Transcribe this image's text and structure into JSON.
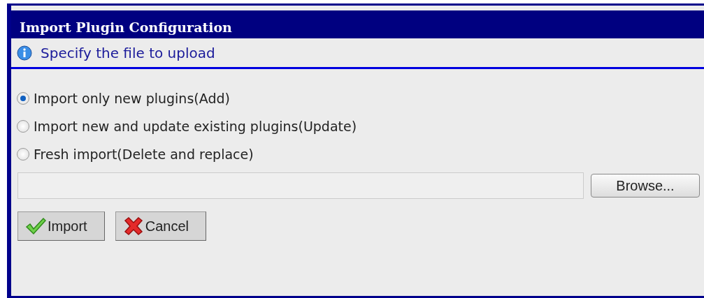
{
  "dialog": {
    "title": "Import Plugin Configuration",
    "info": "Specify the file to upload",
    "options": [
      {
        "label": "Import only new plugins(Add)",
        "selected": true
      },
      {
        "label": "Import new and update existing plugins(Update)",
        "selected": false
      },
      {
        "label": "Fresh import(Delete and replace)",
        "selected": false
      }
    ],
    "browse_button": "Browse...",
    "buttons": [
      {
        "kind": "ok",
        "label": "Import"
      },
      {
        "kind": "cancel",
        "label": "Cancel"
      }
    ]
  }
}
